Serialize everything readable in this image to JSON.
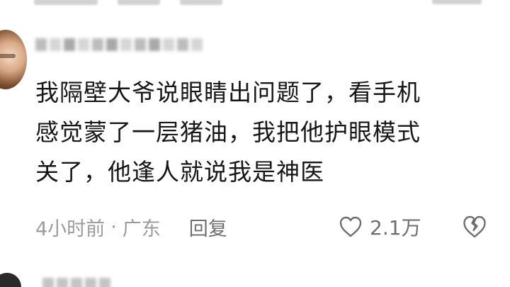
{
  "comment": {
    "username_label": "",
    "lines": [
      "我隔壁大爷说眼睛出问题了，看手机",
      "感觉蒙了一层猪油，我把他护眼模式",
      "关了，他逢人就说我是神医"
    ],
    "time": "4小时前",
    "separator": "·",
    "location": "广东",
    "reply_label": "回复",
    "like_count": "2.1万",
    "icons": {
      "like": "heart-outline-icon",
      "dislike": "broken-heart-icon"
    }
  },
  "colors": {
    "text": "#161616",
    "meta": "#9b9b9b",
    "action": "#6e6e6e",
    "background": "#ffffff"
  }
}
